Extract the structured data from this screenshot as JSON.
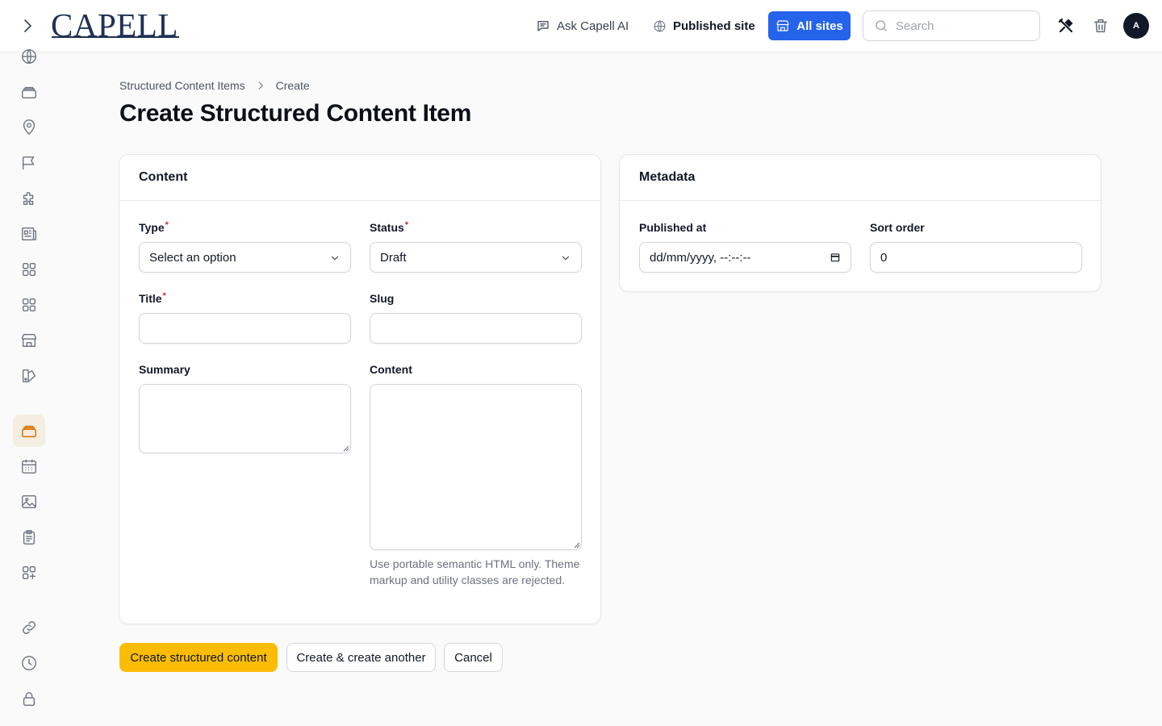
{
  "header": {
    "logo_text": "CAPELL",
    "ask_ai_label": "Ask Capell AI",
    "published_site_label": "Published site",
    "all_sites_label": "All sites",
    "search_placeholder": "Search",
    "avatar_initial": "A",
    "accent_color": "#2563eb"
  },
  "sidebar": {
    "items": [
      {
        "icon": "globe-icon"
      },
      {
        "icon": "stack-icon"
      },
      {
        "icon": "map-pin-icon"
      },
      {
        "icon": "flag-icon"
      },
      {
        "icon": "puzzle-icon"
      },
      {
        "icon": "newspaper-icon"
      },
      {
        "icon": "grid-icon"
      },
      {
        "icon": "grid-icon"
      },
      {
        "icon": "building-icon"
      },
      {
        "icon": "swatch-icon"
      },
      {
        "icon": "stack-icon",
        "active": true,
        "color": "#d97706"
      },
      {
        "icon": "calendar-icon"
      },
      {
        "icon": "image-icon"
      },
      {
        "icon": "clipboard-icon"
      },
      {
        "icon": "grid-plus-icon"
      },
      {
        "icon": "link-icon"
      },
      {
        "icon": "clock-icon"
      },
      {
        "icon": "lock-icon"
      }
    ]
  },
  "breadcrumb": {
    "parent": "Structured Content Items",
    "current": "Create"
  },
  "page_title": "Create Structured Content Item",
  "content_card": {
    "title": "Content",
    "type_label": "Type",
    "type_value": "Select an option",
    "status_label": "Status",
    "status_value": "Draft",
    "title_label": "Title",
    "title_value": "",
    "slug_label": "Slug",
    "slug_value": "",
    "summary_label": "Summary",
    "content_label": "Content",
    "content_help": "Use portable semantic HTML only. Theme markup and utility classes are rejected."
  },
  "meta_card": {
    "title": "Metadata",
    "published_at_label": "Published at",
    "published_at_value": "dd/mm/yyyy, --:--:--",
    "sort_order_label": "Sort order",
    "sort_order_value": "0"
  },
  "actions": {
    "create_label": "Create structured content",
    "create_another_label": "Create & create another",
    "cancel_label": "Cancel",
    "primary_color": "#fbbc05"
  }
}
